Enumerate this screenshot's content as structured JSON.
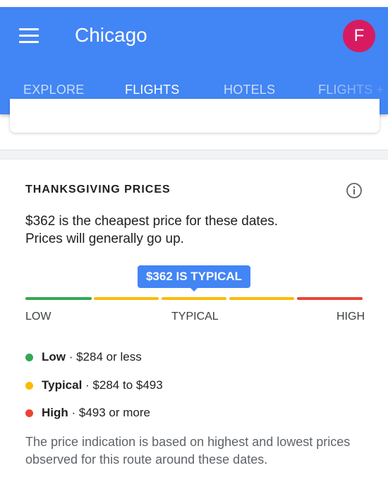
{
  "app": {
    "title": "Chicago",
    "avatar_letter": "F"
  },
  "tabs": [
    {
      "label": "EXPLORE",
      "active": false
    },
    {
      "label": "FLIGHTS",
      "active": true
    },
    {
      "label": "HOTELS",
      "active": false
    },
    {
      "label": "FLIGHTS + ",
      "active": false
    }
  ],
  "prices": {
    "heading": "THANKSGIVING PRICES",
    "summary_line1": "$362 is the cheapest price for these dates.",
    "summary_line2": "Prices will generally go up.",
    "indicator": "$362 IS TYPICAL",
    "scale": {
      "low": "LOW",
      "typical": "TYPICAL",
      "high": "HIGH"
    },
    "legend": [
      {
        "name": "Low",
        "range": " · $284 or less",
        "color": "#34a853"
      },
      {
        "name": "Typical",
        "range": " · $284 to $493",
        "color": "#fbbc04"
      },
      {
        "name": "High",
        "range": " · $493 or more",
        "color": "#ea4335"
      }
    ],
    "footnote": "The price indication is based on highest and lowest prices observed for this route around these dates."
  },
  "colors": {
    "primary": "#4285f4",
    "low": "#34a853",
    "typical": "#fbbc04",
    "high": "#ea4335",
    "avatar": "#d81b60"
  }
}
